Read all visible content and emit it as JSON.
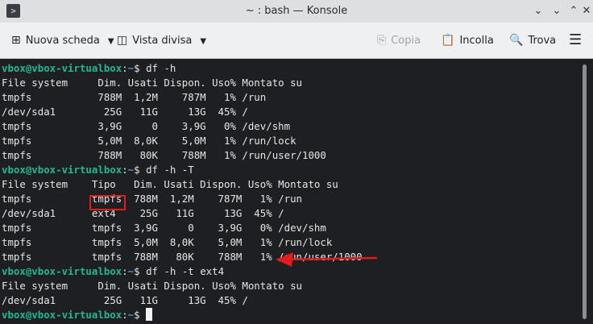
{
  "window": {
    "title": "~ : bash — Konsole",
    "app_icon": "terminal-icon",
    "controls": [
      "chevron-down-icon",
      "minimize-icon",
      "maximize-icon",
      "close-icon"
    ]
  },
  "toolbar": {
    "new_tab": "Nuova scheda",
    "split_view": "Vista divisa",
    "copy": "Copia",
    "paste": "Incolla",
    "find": "Trova"
  },
  "terminal": {
    "prompt": "vbox@vbox-virtualbox",
    "path": "~",
    "lines": [
      {
        "cmd": " df -h"
      },
      {
        "text": "File system     Dim. Usati Dispon. Uso% Montato su"
      },
      {
        "text": "tmpfs           788M  1,2M    787M   1% /run"
      },
      {
        "text": "/dev/sda1        25G   11G     13G  45% /"
      },
      {
        "text": "tmpfs           3,9G     0    3,9G   0% /dev/shm"
      },
      {
        "text": "tmpfs           5,0M  8,0K    5,0M   1% /run/lock"
      },
      {
        "text": "tmpfs           788M   80K    788M   1% /run/user/1000"
      },
      {
        "cmd": " df -h -T"
      },
      {
        "text": "File system    Tipo   Dim. Usati Dispon. Uso% Montato su"
      },
      {
        "text": "tmpfs          tmpfs  788M  1,2M    787M   1% /run"
      },
      {
        "text": "/dev/sda1      ext4    25G   11G     13G  45% /"
      },
      {
        "text": "tmpfs          tmpfs  3,9G     0    3,9G   0% /dev/shm"
      },
      {
        "text": "tmpfs          tmpfs  5,0M  8,0K    5,0M   1% /run/lock"
      },
      {
        "text": "tmpfs          tmpfs  788M   80K    788M   1% /run/user/1000"
      },
      {
        "cmd": " df -h -t ext4"
      },
      {
        "text": "File system     Dim. Usati Dispon. Uso% Montato su"
      },
      {
        "text": "/dev/sda1        25G   11G     13G  45% /"
      },
      {
        "cmd": " "
      }
    ]
  },
  "annotation_color": "#e01c1c"
}
